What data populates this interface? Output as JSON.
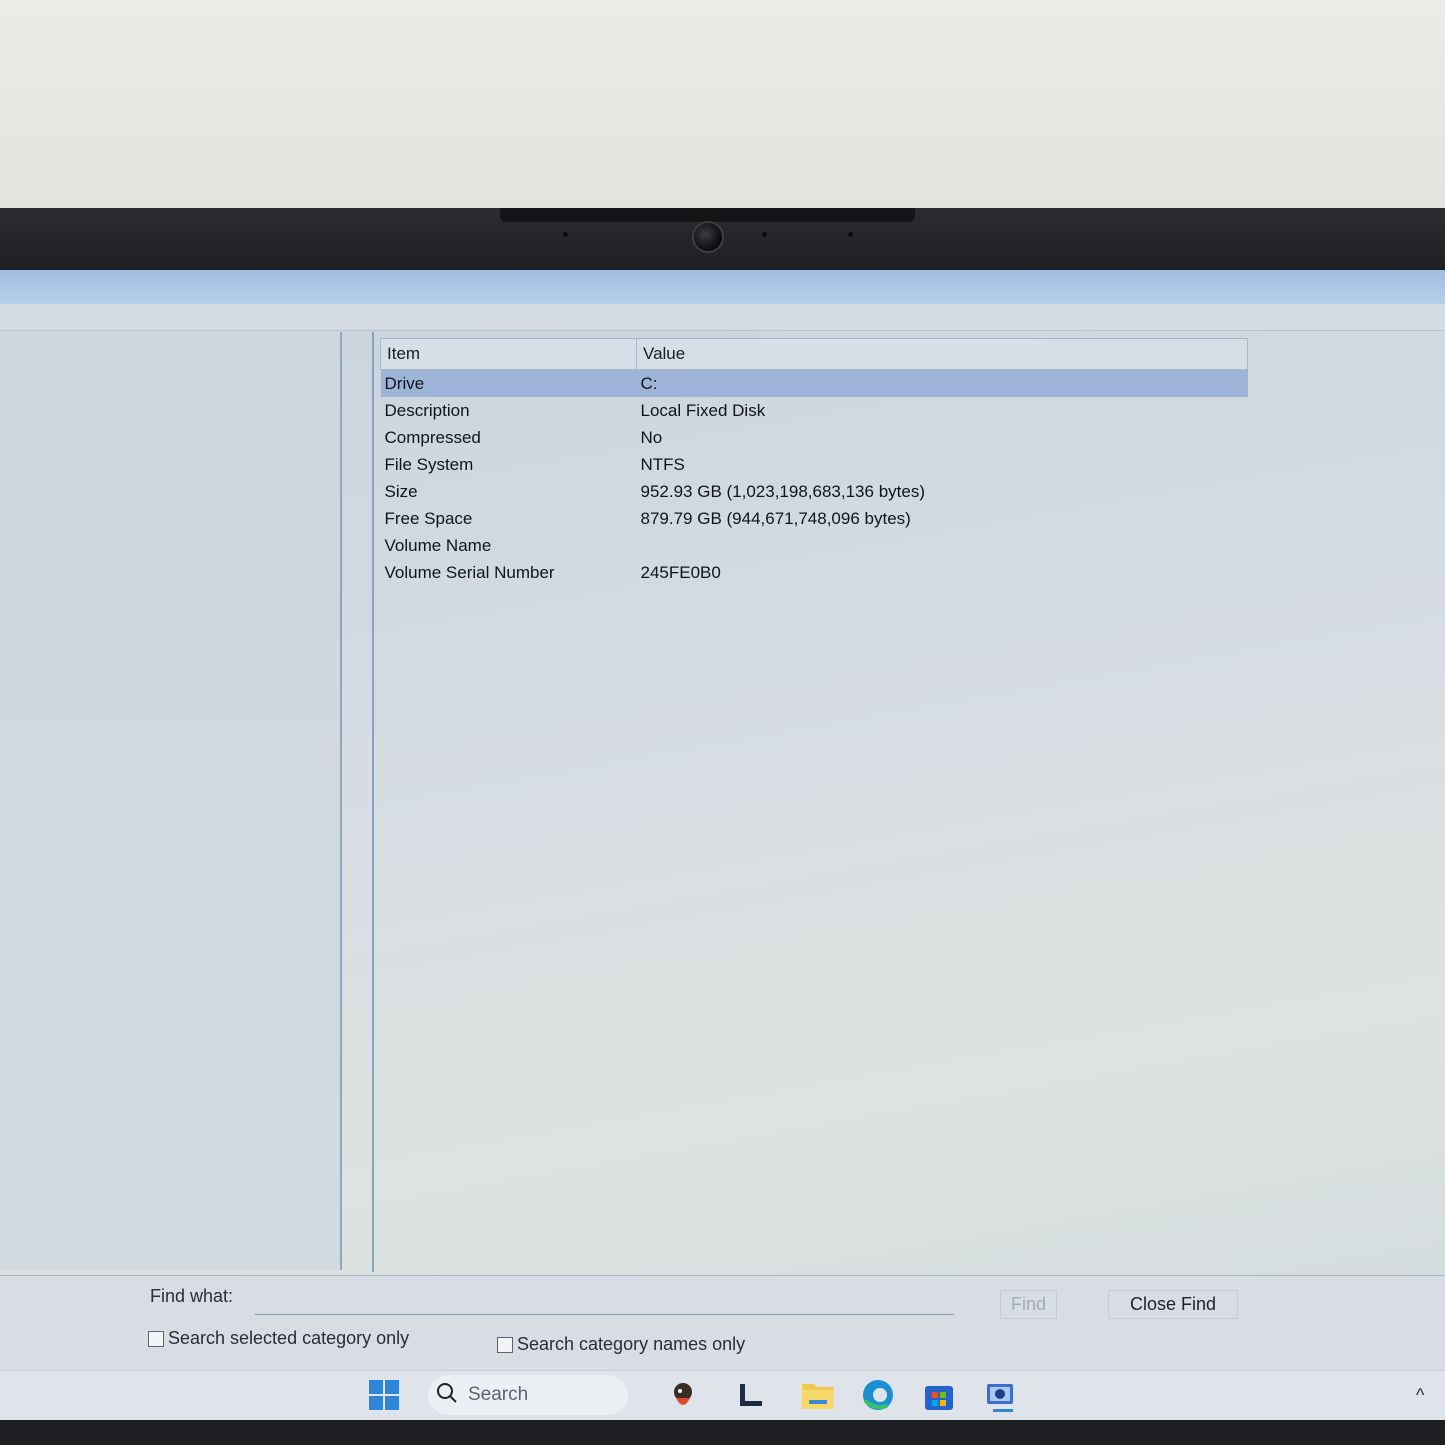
{
  "window": {
    "title": ""
  },
  "table": {
    "headers": {
      "item": "Item",
      "value": "Value"
    },
    "rows": [
      {
        "item": "Drive",
        "value": "C:",
        "selected": true
      },
      {
        "item": "Description",
        "value": "Local Fixed Disk"
      },
      {
        "item": "Compressed",
        "value": "No"
      },
      {
        "item": "File System",
        "value": "NTFS"
      },
      {
        "item": "Size",
        "value": "952.93 GB (1,023,198,683,136 bytes)"
      },
      {
        "item": "Free Space",
        "value": "879.79 GB (944,671,748,096 bytes)"
      },
      {
        "item": "Volume Name",
        "value": ""
      },
      {
        "item": "Volume Serial Number",
        "value": "245FE0B0"
      }
    ]
  },
  "find": {
    "label": "Find what:",
    "input_value": "",
    "find_button": "Find",
    "close_button": "Close Find",
    "check_selected_category": "Search selected category only",
    "check_category_names": "Search category names only"
  },
  "taskbar": {
    "search_label": "Search",
    "icons": [
      "windows-start-icon",
      "search-icon",
      "browser-mascot-icon",
      "task-view-icon",
      "file-explorer-icon",
      "edge-browser-icon",
      "microsoft-store-icon",
      "system-information-icon"
    ],
    "chevron": "^"
  },
  "colors": {
    "selection": "#9db4d8",
    "start_blue": "#2f86d6"
  }
}
